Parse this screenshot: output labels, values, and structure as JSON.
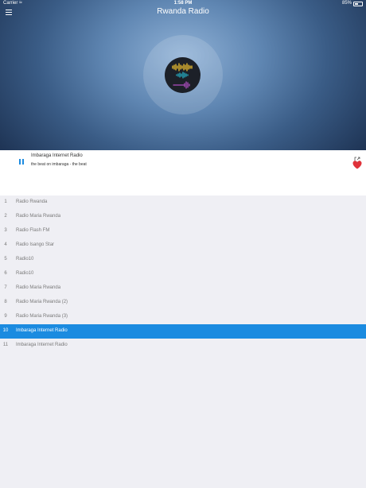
{
  "status_bar": {
    "carrier": "Carrier",
    "time": "1:58 PM",
    "battery": "85%"
  },
  "header": {
    "title": "Rwanda Radio"
  },
  "now_playing": {
    "title": "Imbaraga Internet Radio",
    "subtitle": "the beat on imbaraga - the beat"
  },
  "stations": [
    {
      "num": "1",
      "name": "Radio Rwanda"
    },
    {
      "num": "2",
      "name": "Radio Maria Rwanda"
    },
    {
      "num": "3",
      "name": "Radio Flash FM"
    },
    {
      "num": "4",
      "name": "Radio Isango Star"
    },
    {
      "num": "5",
      "name": "Radio10"
    },
    {
      "num": "6",
      "name": "Radio10"
    },
    {
      "num": "7",
      "name": "Radio Maria Rwanda"
    },
    {
      "num": "8",
      "name": "Radio Maria Rwanda (2)"
    },
    {
      "num": "9",
      "name": "Radio Maria Rwanda (3)"
    },
    {
      "num": "10",
      "name": "Imbaraga Internet Radio"
    },
    {
      "num": "11",
      "name": "Imbaraga Internet Radio"
    }
  ],
  "active_index": 9,
  "colors": {
    "accent": "#1b8be0",
    "heart": "#e0323a",
    "wave_yellow": "#f2c230",
    "wave_teal": "#27b3c9",
    "wave_purple": "#b04ec2"
  },
  "icons": [
    "menu-icon",
    "wifi-icon",
    "battery-icon",
    "pause-icon",
    "share-icon",
    "heart-icon",
    "sound-wave-icon"
  ]
}
